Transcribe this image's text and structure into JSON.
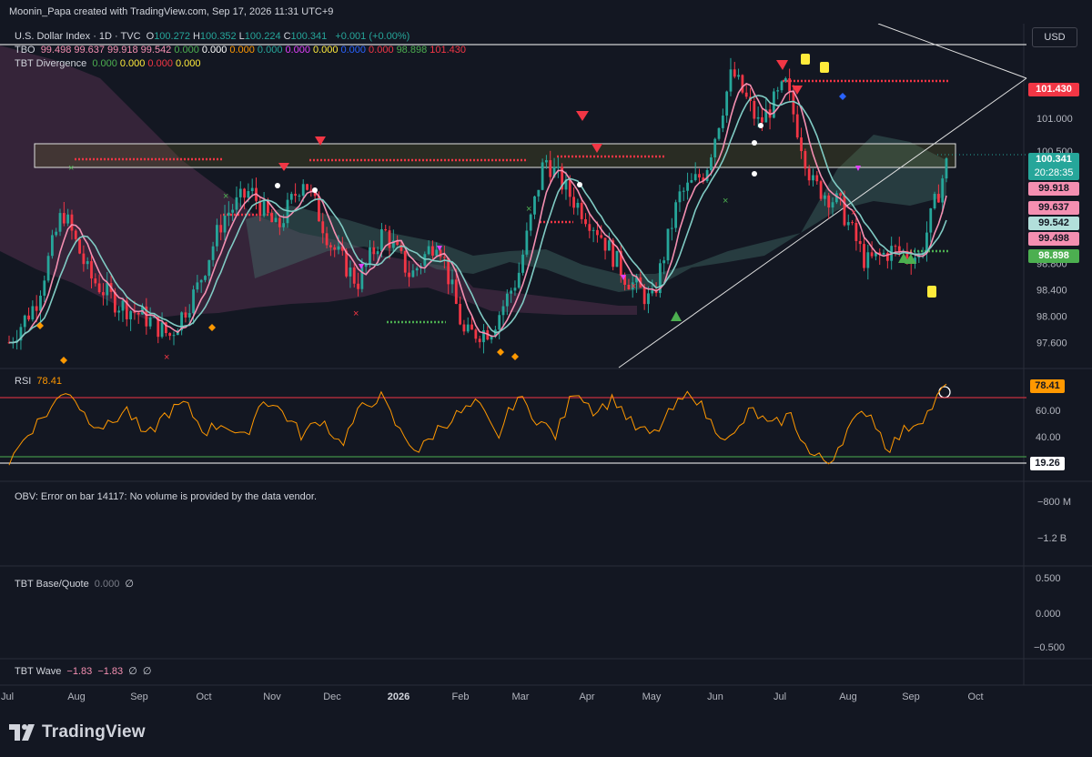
{
  "header": {
    "credit": "Moonin_Papa created with TradingView.com, Sep 17, 2026 11:31 UTC+9"
  },
  "currency_button": "USD",
  "legend": {
    "symbol": "U.S. Dollar Index · 1D · TVC",
    "ohlc": [
      {
        "k": "O",
        "v": "100.272"
      },
      {
        "k": "H",
        "v": "100.352"
      },
      {
        "k": "L",
        "v": "100.224"
      },
      {
        "k": "C",
        "v": "100.341"
      }
    ],
    "change": "+0.001 (+0.00%)",
    "tbo_name": "TBO",
    "tbo_values": [
      {
        "v": "99.498",
        "c": "#f48fb1"
      },
      {
        "v": "99.637",
        "c": "#f48fb1"
      },
      {
        "v": "99.918",
        "c": "#f48fb1"
      },
      {
        "v": "99.542",
        "c": "#f48fb1"
      },
      {
        "v": "0.000",
        "c": "#4caf50"
      },
      {
        "v": "0.000",
        "c": "#ffffff"
      },
      {
        "v": "0.000",
        "c": "#ff9800"
      },
      {
        "v": "0.000",
        "c": "#26a69a"
      },
      {
        "v": "0.000",
        "c": "#e040fb"
      },
      {
        "v": "0.000",
        "c": "#ffeb3b"
      },
      {
        "v": "0.000",
        "c": "#2962ff"
      },
      {
        "v": "0.000",
        "c": "#f23645"
      },
      {
        "v": "98.898",
        "c": "#4caf50"
      },
      {
        "v": "101.430",
        "c": "#f23645"
      }
    ],
    "div_name": "TBT Divergence",
    "div_values": [
      {
        "v": "0.000",
        "c": "#4caf50"
      },
      {
        "v": "0.000",
        "c": "#ffeb3b"
      },
      {
        "v": "0.000",
        "c": "#f23645"
      },
      {
        "v": "0.000",
        "c": "#ffeb3b"
      }
    ]
  },
  "chart_data": {
    "type": "candlestick",
    "symbol": "U.S. Dollar Index",
    "interval": "1D",
    "x_labels": [
      "Jul",
      "Aug",
      "Sep",
      "Oct",
      "Nov",
      "Dec",
      "2026",
      "Feb",
      "Mar",
      "Apr",
      "May",
      "Jun",
      "Jul",
      "Aug",
      "Sep",
      "Oct"
    ],
    "y_ticks": [
      "97.600",
      "98.000",
      "98.400",
      "98.800",
      "101.000",
      "100.500"
    ],
    "ylim": [
      97.3,
      102.1
    ],
    "close_path": [
      [
        "Jul",
        97.6
      ],
      [
        "Jul",
        98.2
      ],
      [
        "Aug",
        99.6
      ],
      [
        "Aug",
        98.6
      ],
      [
        "Sep",
        98.2
      ],
      [
        "Sep",
        98.0
      ],
      [
        "Oct",
        97.7
      ],
      [
        "Oct",
        98.4
      ],
      [
        "Oct",
        99.5
      ],
      [
        "Nov",
        99.9
      ],
      [
        "Nov",
        99.3
      ],
      [
        "Nov",
        100.1
      ],
      [
        "Dec",
        99.1
      ],
      [
        "Dec",
        98.5
      ],
      [
        "Dec",
        99.3
      ],
      [
        "2026",
        98.6
      ],
      [
        "2026",
        99.2
      ],
      [
        "Feb",
        97.7
      ],
      [
        "Feb",
        97.8
      ],
      [
        "Mar",
        98.6
      ],
      [
        "Mar",
        100.4
      ],
      [
        "Apr",
        99.8
      ],
      [
        "Apr",
        99.3
      ],
      [
        "May",
        98.6
      ],
      [
        "May",
        98.2
      ],
      [
        "Jun",
        99.8
      ],
      [
        "Jun",
        100.2
      ],
      [
        "Jul",
        101.7
      ],
      [
        "Jul",
        100.9
      ],
      [
        "Jul",
        101.5
      ],
      [
        "Aug",
        100.0
      ],
      [
        "Aug",
        99.7
      ],
      [
        "Aug",
        98.8
      ],
      [
        "Sep",
        99.0
      ],
      [
        "Sep",
        98.9
      ],
      [
        "Sep",
        100.3
      ]
    ],
    "lines": [
      {
        "name": "fast",
        "color": "#f48fb1"
      },
      {
        "name": "mid",
        "color": "#80cbc4"
      }
    ],
    "price_labels": [
      {
        "v": "101.430",
        "bg": "#f23645",
        "fg": "#ffffff"
      },
      {
        "v": "100.341",
        "bg": "#26a69a",
        "fg": "#ffffff",
        "sub": "20:28:35"
      },
      {
        "v": "99.918",
        "bg": "#f48fb1",
        "fg": "#131722"
      },
      {
        "v": "99.637",
        "bg": "#f48fb1",
        "fg": "#131722"
      },
      {
        "v": "99.542",
        "bg": "#b2dfdb",
        "fg": "#131722"
      },
      {
        "v": "99.498",
        "bg": "#f48fb1",
        "fg": "#131722"
      },
      {
        "v": "98.898",
        "bg": "#4caf50",
        "fg": "#ffffff"
      }
    ],
    "rsi": {
      "name": "RSI",
      "value": "78.41",
      "overbought_value": "78.41",
      "oversold_value": "19.26",
      "ticks": [
        "60.00",
        "40.00"
      ],
      "color": "#ff9800",
      "values": [
        22,
        45,
        60,
        78,
        55,
        48,
        62,
        40,
        58,
        66,
        45,
        52,
        38,
        70,
        60,
        42,
        55,
        35,
        62,
        72,
        45,
        30,
        48,
        58,
        66,
        40,
        72,
        55,
        42,
        78,
        60,
        70,
        48,
        42,
        62,
        75,
        50,
        38,
        62,
        48,
        58,
        28,
        22,
        48,
        62,
        32,
        48,
        58,
        80
      ]
    },
    "obv": {
      "text": "OBV: Error on bar 14117: No volume is provided by the data vendor.",
      "ticks": [
        "−800 M",
        "−1.2 B"
      ]
    },
    "base_quote": {
      "name": "TBT Base/Quote",
      "value": "0.000",
      "null": "∅",
      "ticks": [
        "0.500",
        "0.000",
        "−0.500"
      ]
    },
    "wave": {
      "name": "TBT Wave",
      "v1": "−1.83",
      "v2": "−1.83",
      "n1": "∅",
      "n2": "∅"
    }
  },
  "brand": "TradingView"
}
